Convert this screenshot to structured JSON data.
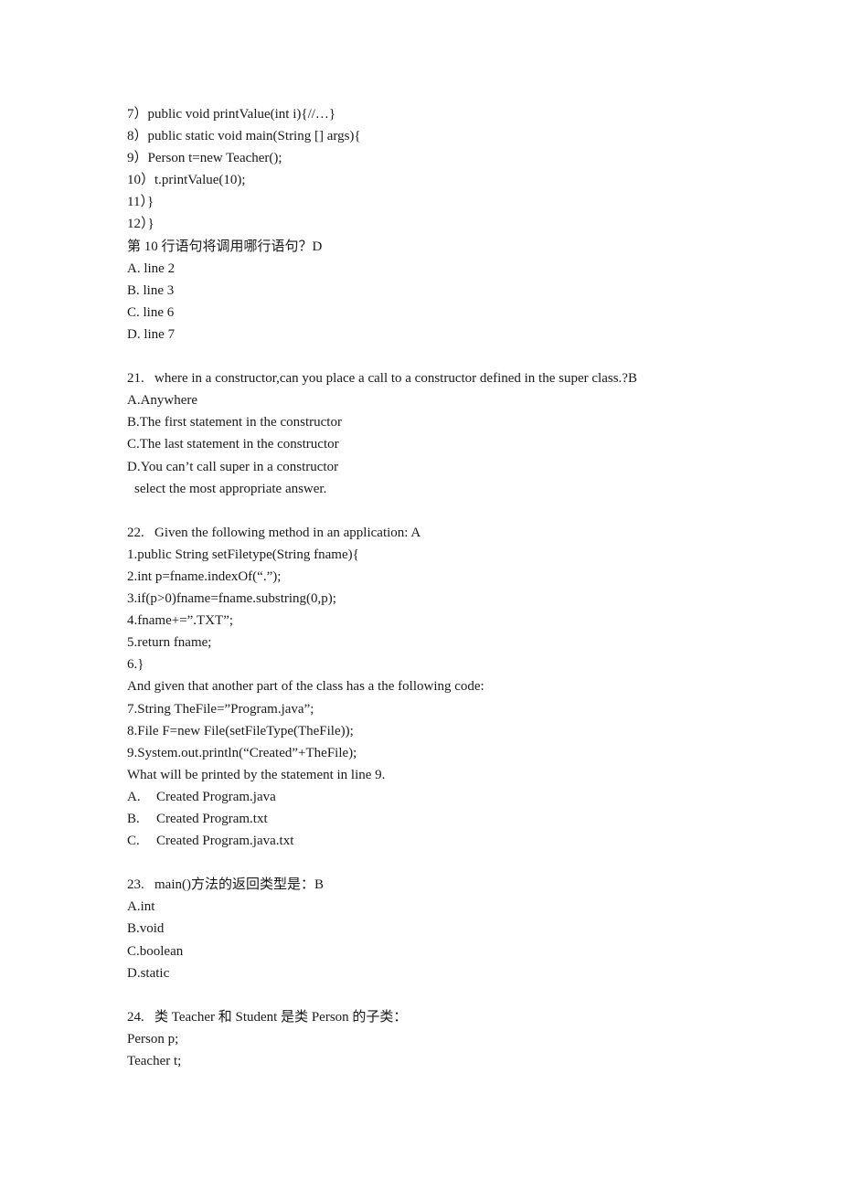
{
  "document": {
    "q20_tail": {
      "code_lines": [
        "7）public void printValue(int i){//…}",
        "8）public static void main(String [] args){",
        "9）Person t=new Teacher();",
        "10）t.printValue(10);",
        "11）}",
        "12）}"
      ],
      "question": "第 10 行语句将调用哪行语句？D",
      "options": [
        "A. line 2",
        "B. line 3",
        "C. line 6",
        "D. line 7"
      ]
    },
    "q21": {
      "question": "21.   where in a constructor,can you place a call to a constructor defined in the super class.?B",
      "options": [
        "A.Anywhere",
        "B.The first statement in the constructor",
        "C.The last statement in the constructor",
        "D.You can’t call super in a constructor"
      ],
      "note": "select the most appropriate answer."
    },
    "q22": {
      "question": "22.   Given the following method in an application: A",
      "method_lines": [
        "1.public String setFiletype(String fname){",
        "2.int p=fname.indexOf(“.”);",
        "3.if(p>0)fname=fname.substring(0,p);",
        "4.fname+=”.TXT”;",
        "5.return fname;",
        "6.}"
      ],
      "context": "And given that another part of the class has a the following code:",
      "code_lines": [
        "7.String TheFile=”Program.java”;",
        "8.File F=new File(setFileType(TheFile));",
        "9.System.out.println(“Created”+TheFile);"
      ],
      "prompt": "What will be printed by the statement in line 9.",
      "options": [
        {
          "letter": "A.",
          "text": "Created Program.java"
        },
        {
          "letter": "B.",
          "text": "Created Program.txt"
        },
        {
          "letter": "C.",
          "text": "Created Program.java.txt"
        }
      ]
    },
    "q23": {
      "question": "23.   main()方法的返回类型是：B",
      "options": [
        "A.int",
        "B.void",
        "C.boolean",
        "D.static"
      ]
    },
    "q24": {
      "question": "24.   类 Teacher 和 Student 是类 Person 的子类：",
      "code_lines": [
        "Person p;",
        "Teacher t;"
      ]
    }
  }
}
